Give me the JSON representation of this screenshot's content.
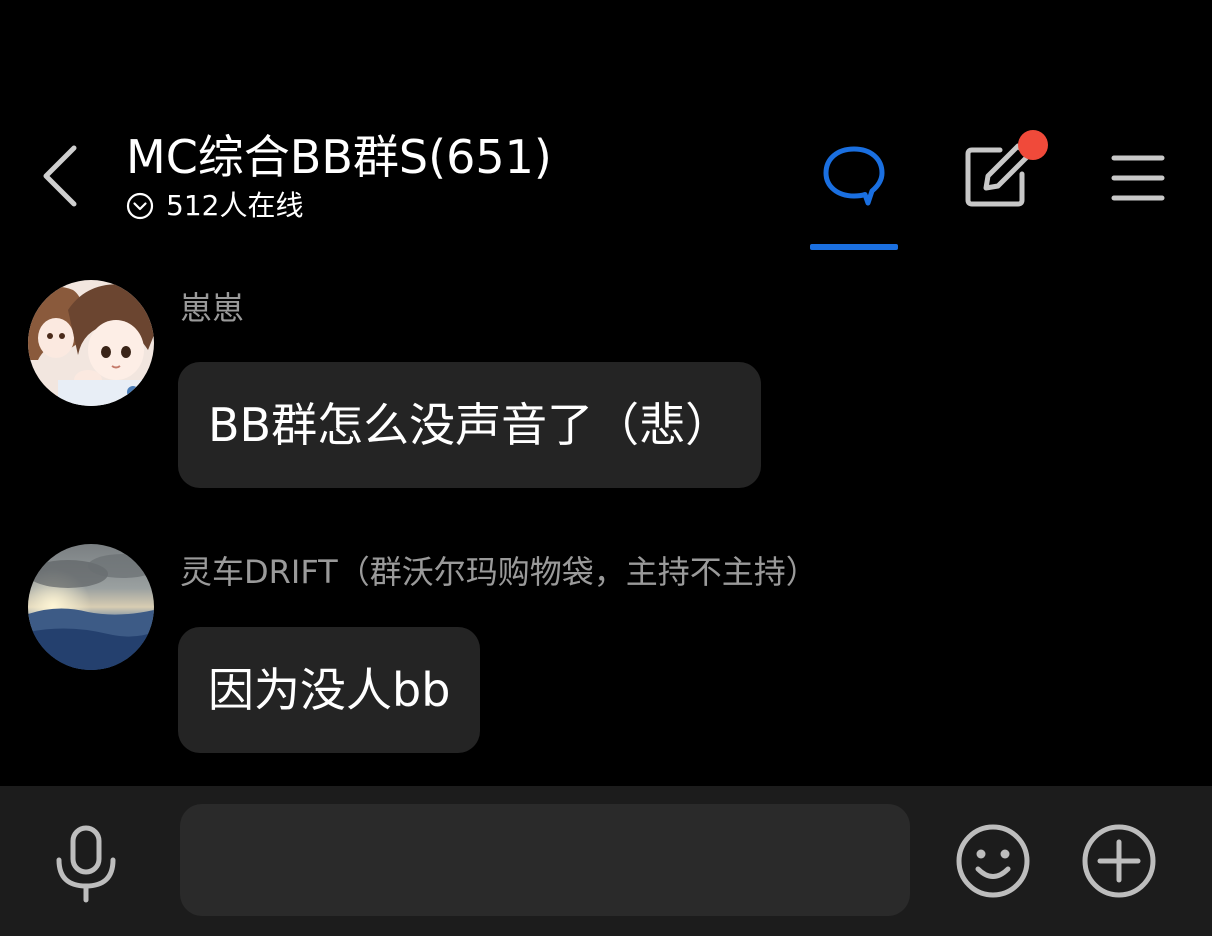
{
  "header": {
    "title": "MC综合BB群S(651)",
    "online_status": "512人在线",
    "back_icon": "chevron-left-icon",
    "tabs": [
      {
        "icon": "chat-bubble-icon",
        "active": true
      },
      {
        "icon": "edit-note-icon",
        "badge": "red-dot"
      }
    ],
    "menu_icon": "hamburger-menu-icon"
  },
  "messages": [
    {
      "sender": "崽崽",
      "text": "BB群怎么没声音了（悲）",
      "avatar": "anime-avatar"
    },
    {
      "sender": "灵车DRIFT（群沃尔玛购物袋，主持不主持）",
      "text": "因为没人bb",
      "avatar": "sky-landscape-avatar"
    }
  ],
  "input_bar": {
    "mic_icon": "microphone-icon",
    "input_value": "",
    "emoji_icon": "smiley-icon",
    "plus_icon": "plus-circle-icon"
  },
  "colors": {
    "background": "#000000",
    "accent": "#1a6fe0",
    "badge": "#f04a3a",
    "bubble": "#242424",
    "sender_name": "#9a9a9a",
    "input_bar": "#1c1c1c"
  }
}
